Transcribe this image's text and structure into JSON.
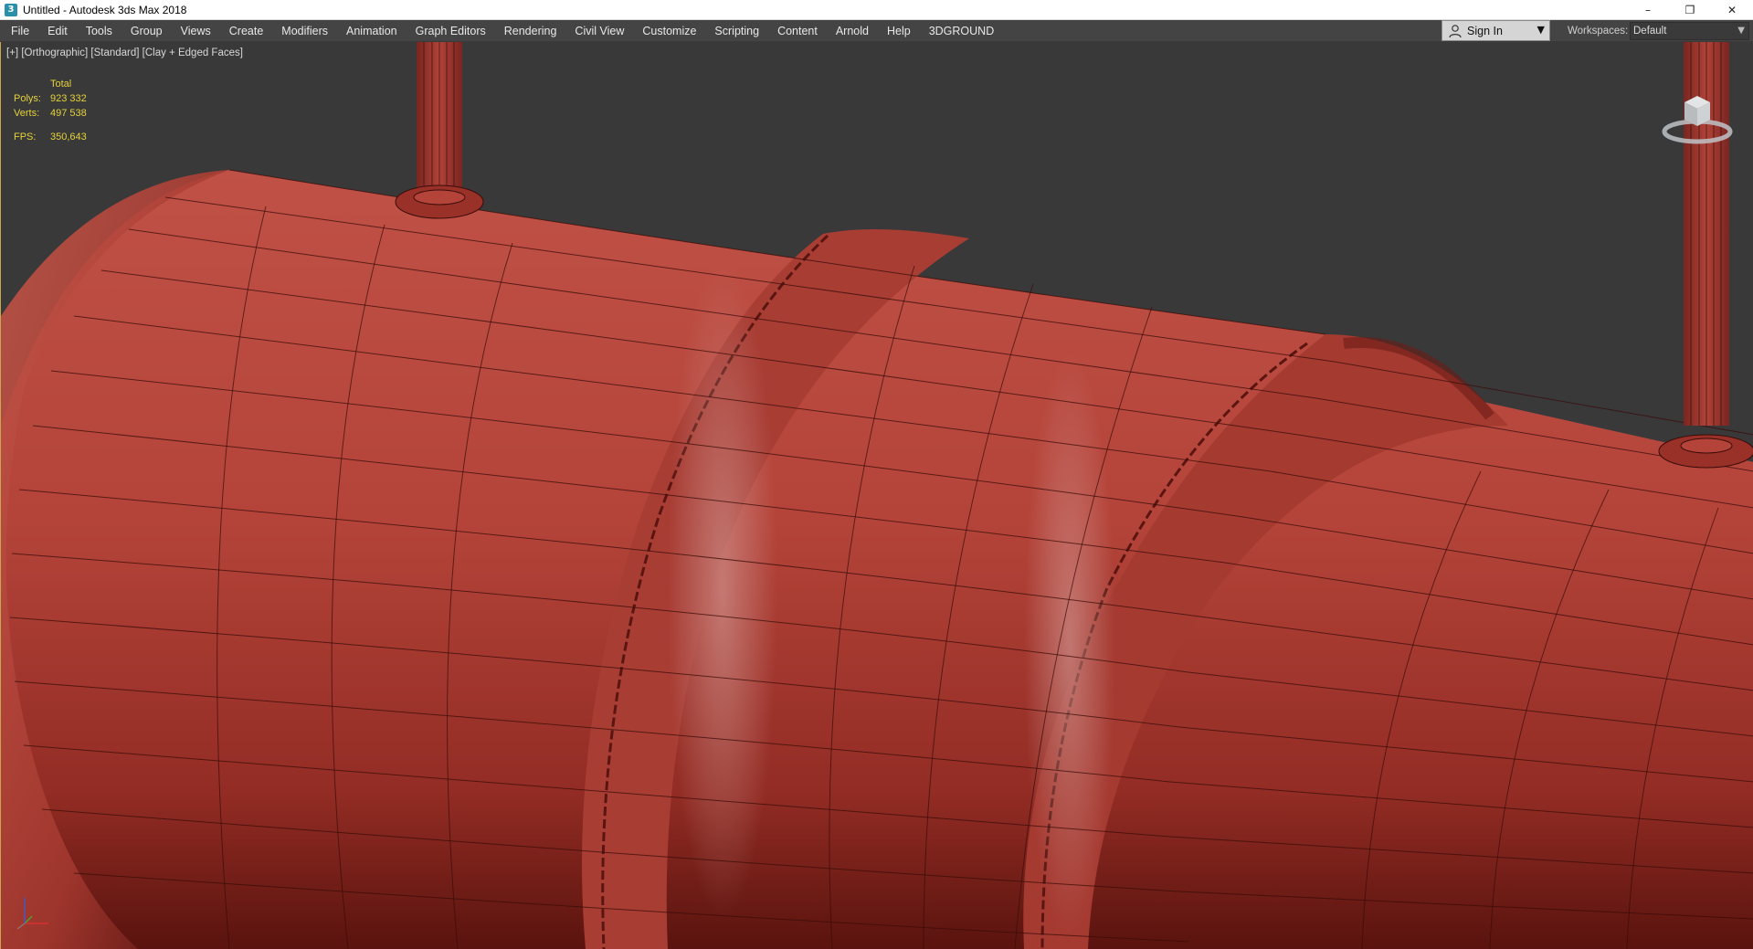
{
  "window": {
    "title": "Untitled - Autodesk 3ds Max 2018",
    "app_icon": "3ds-max-icon",
    "controls": {
      "minimize": "–",
      "restore": "❐",
      "close": "✕"
    }
  },
  "menubar": {
    "items": [
      "File",
      "Edit",
      "Tools",
      "Group",
      "Views",
      "Create",
      "Modifiers",
      "Animation",
      "Graph Editors",
      "Rendering",
      "Civil View",
      "Customize",
      "Scripting",
      "Content",
      "Arnold",
      "Help",
      "3DGROUND"
    ],
    "sign_in_label": "Sign In",
    "workspaces_label": "Workspaces:",
    "workspace_value": "Default"
  },
  "viewport": {
    "label_plus": "[+]",
    "label_view": "[Orthographic]",
    "label_shading": "[Standard]",
    "label_style": "[Clay + Edged Faces]",
    "stats": {
      "header": "Total",
      "polys_label": "Polys:",
      "polys_value": "923 332",
      "verts_label": "Verts:",
      "verts_value": "497 538",
      "fps_label": "FPS:",
      "fps_value": "350,643"
    },
    "colors": {
      "background": "#393939",
      "clay": "#b7463b",
      "stats_text": "#e6d23a",
      "axis_x": "#e03030",
      "axis_y": "#30c030",
      "axis_z": "#3060e0"
    }
  }
}
